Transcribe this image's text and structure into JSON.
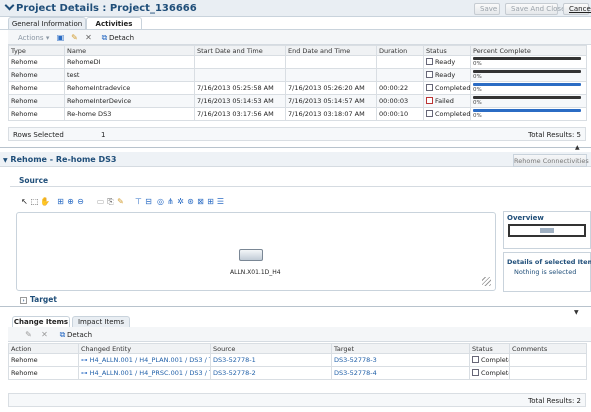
{
  "header": {
    "title": "Project Details : Project_136666",
    "buttons": {
      "save": "Save",
      "save_close": "Save And Close",
      "cancel": "Cancel"
    }
  },
  "tabs": [
    {
      "label": "General Information"
    },
    {
      "label": "Activities"
    }
  ],
  "activities": {
    "toolbar": {
      "actions": "Actions",
      "detach": "Detach"
    },
    "columns": [
      "Type",
      "Name",
      "Start Date and Time",
      "End Date and Time",
      "Duration",
      "Status",
      "Percent Complete"
    ],
    "rows": [
      {
        "type": "Rehome",
        "name": "RehomeDI",
        "start": "",
        "end": "",
        "duration": "",
        "status": "Ready",
        "percent": "0%",
        "bar": "dark"
      },
      {
        "type": "Rehome",
        "name": "test",
        "start": "",
        "end": "",
        "duration": "",
        "status": "Ready",
        "percent": "0%",
        "bar": "dark"
      },
      {
        "type": "Rehome",
        "name": "RehomeIntradevice",
        "start": "7/16/2013 05:25:58 AM",
        "end": "7/16/2013 05:26:20 AM",
        "duration": "00:00:22",
        "status": "Completed",
        "percent": "0%",
        "bar": "blue"
      },
      {
        "type": "Rehome",
        "name": "RehomeInterDevice",
        "start": "7/16/2013 05:14:53 AM",
        "end": "7/16/2013 05:14:57 AM",
        "duration": "00:00:03",
        "status": "Failed",
        "percent": "0%",
        "bar": "dark"
      },
      {
        "type": "Rehome",
        "name": "Re-home DS3",
        "start": "7/16/2013 03:17:56 AM",
        "end": "7/16/2013 03:18:07 AM",
        "duration": "00:00:10",
        "status": "Completed",
        "percent": "0%",
        "bar": "blue"
      }
    ],
    "footer": {
      "rows_selected_label": "Rows Selected",
      "rows_selected": "1",
      "total": "Total Results: 5"
    }
  },
  "detail": {
    "title": "Rehome - Re-home DS3",
    "connectivities_button": "Rehome Connectivities",
    "source_label": "Source",
    "node_label": "ALLN.X01.1D_H4",
    "overview_label": "Overview",
    "selected_label": "Details of selected Item",
    "selected_value": "Nothing is selected",
    "target_label": "Target"
  },
  "change": {
    "tabs": [
      {
        "label": "Change Items"
      },
      {
        "label": "Impact Items"
      }
    ],
    "detach": "Detach",
    "columns": [
      "Action",
      "Changed Entity",
      "Source",
      "Target",
      "Status",
      "Comments"
    ],
    "rows": [
      {
        "action": "Rehome",
        "entity": "H4_ALLN.001 / H4_PLAN.001 / DS3 / T3 /",
        "source": "DS3-52778-1",
        "target": "DS3-52778-3",
        "status": "Complete",
        "comments": ""
      },
      {
        "action": "Rehome",
        "entity": "H4_ALLN.001 / H4_PRSC.001 / DS3 / T3 /",
        "source": "DS3-52778-2",
        "target": "DS3-52778-4",
        "status": "Complete",
        "comments": ""
      }
    ],
    "total": "Total Results: 2"
  }
}
